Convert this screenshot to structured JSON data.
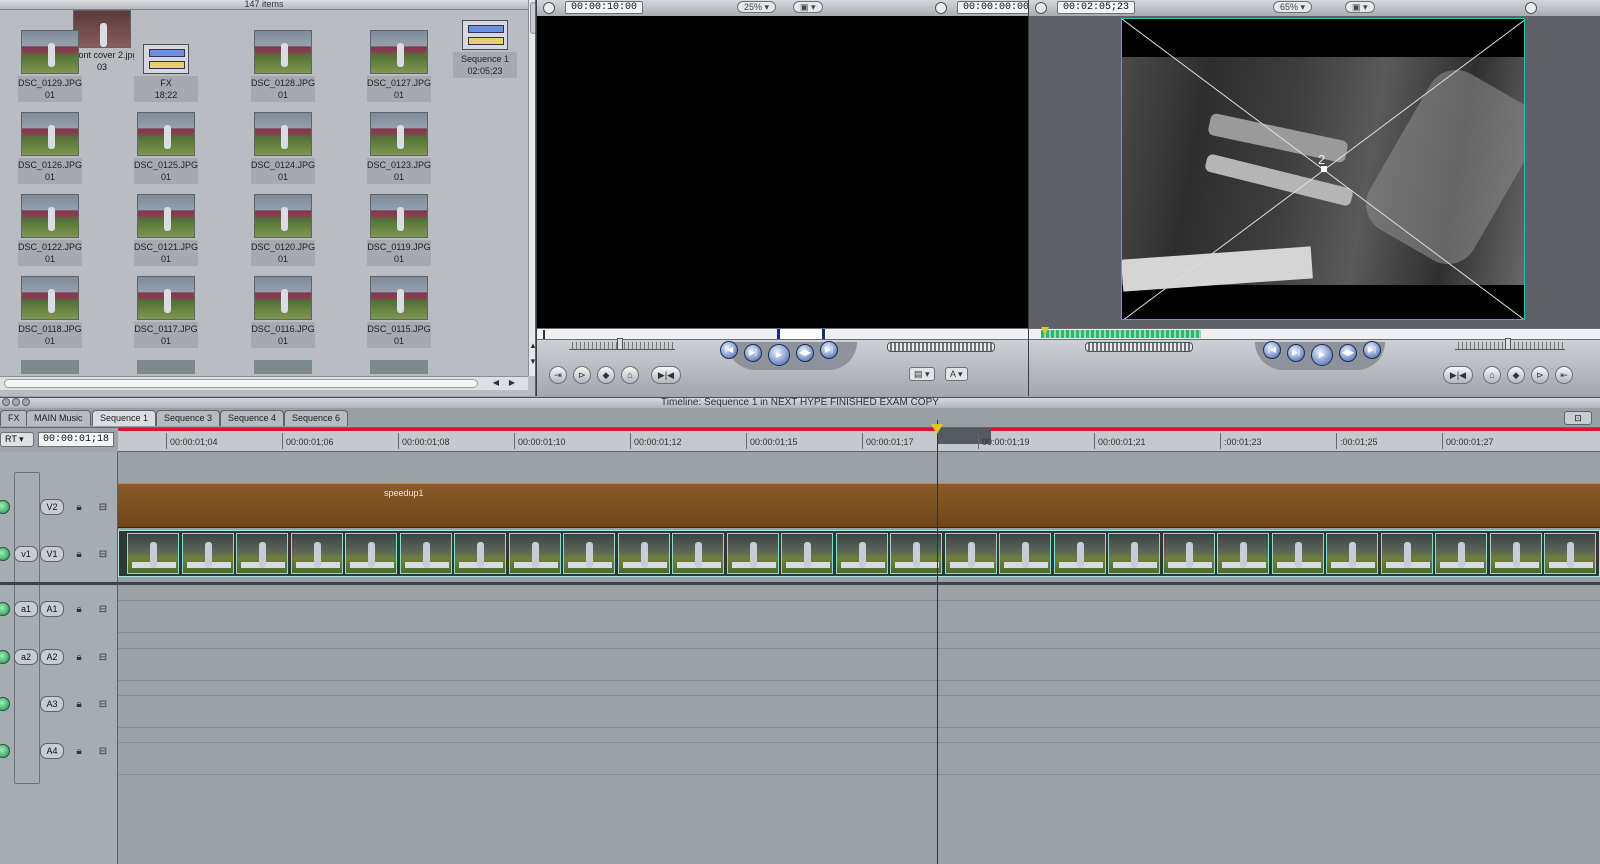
{
  "browser": {
    "item_count": "147 items",
    "items": [
      {
        "name": "Front cover 2.jpg",
        "sub": "03",
        "type": "image"
      },
      {
        "name": "DSC_0129.JPG",
        "sub": "01",
        "type": "image"
      },
      {
        "name": "FX",
        "sub": "18;22",
        "type": "sequence"
      },
      {
        "name": "DSC_0128.JPG",
        "sub": "01",
        "type": "image"
      },
      {
        "name": "DSC_0127.JPG",
        "sub": "01",
        "type": "image"
      },
      {
        "name": "Sequence 1",
        "sub": "02:05;23",
        "type": "sequence"
      },
      {
        "name": "DSC_0126.JPG",
        "sub": "01",
        "type": "image"
      },
      {
        "name": "DSC_0125.JPG",
        "sub": "01",
        "type": "image"
      },
      {
        "name": "DSC_0124.JPG",
        "sub": "01",
        "type": "image"
      },
      {
        "name": "DSC_0123.JPG",
        "sub": "01",
        "type": "image"
      },
      {
        "name": "DSC_0122.JPG",
        "sub": "01",
        "type": "image"
      },
      {
        "name": "DSC_0121.JPG",
        "sub": "01",
        "type": "image"
      },
      {
        "name": "DSC_0120.JPG",
        "sub": "01",
        "type": "image"
      },
      {
        "name": "DSC_0119.JPG",
        "sub": "01",
        "type": "image"
      },
      {
        "name": "DSC_0118.JPG",
        "sub": "01",
        "type": "image"
      },
      {
        "name": "DSC_0117.JPG",
        "sub": "01",
        "type": "image"
      },
      {
        "name": "DSC_0116.JPG",
        "sub": "01",
        "type": "image"
      },
      {
        "name": "DSC_0115.JPG",
        "sub": "01",
        "type": "image"
      }
    ]
  },
  "viewer": {
    "duration_tc": "00:00:10:00",
    "zoom": "25%",
    "current_tc": "00:00:00:00"
  },
  "canvas": {
    "duration_tc": "00:02:05;23",
    "zoom": "65%",
    "overlay_label": "2"
  },
  "timeline": {
    "title": "Timeline: Sequence 1 in NEXT HYPE FINISHED EXAM COPY",
    "tabs": [
      "FX",
      "MAIN Music",
      "Sequence 1",
      "Sequence 3",
      "Sequence 4",
      "Sequence 6"
    ],
    "active_tab": "Sequence 1",
    "rt_label": "RT",
    "current_tc": "00:00:01;18",
    "ruler_ticks": [
      "00:00:01;04",
      "00:00:01;06",
      "00:00:01;08",
      "00:00:01;10",
      "00:00:01;12",
      "00:00:01;15",
      "00:00:01;17",
      "00:00:01;19",
      "00:00:01;21",
      ":00:01;23",
      ":00:01;25",
      "00:00:01;27"
    ],
    "v2_clip_label": "speedup1",
    "tracks": [
      {
        "src": "",
        "dst": "V2"
      },
      {
        "src": "v1",
        "dst": "V1"
      },
      {
        "src": "a1",
        "dst": "A1"
      },
      {
        "src": "a2",
        "dst": "A2"
      },
      {
        "src": "",
        "dst": "A3"
      },
      {
        "src": "",
        "dst": "A4"
      }
    ]
  },
  "colors": {
    "speed_clip": "#7a4b1d",
    "clip_border": "#9ee7e2",
    "playhead_marker": "#e0c820",
    "ruler_red": "#d8182a"
  }
}
